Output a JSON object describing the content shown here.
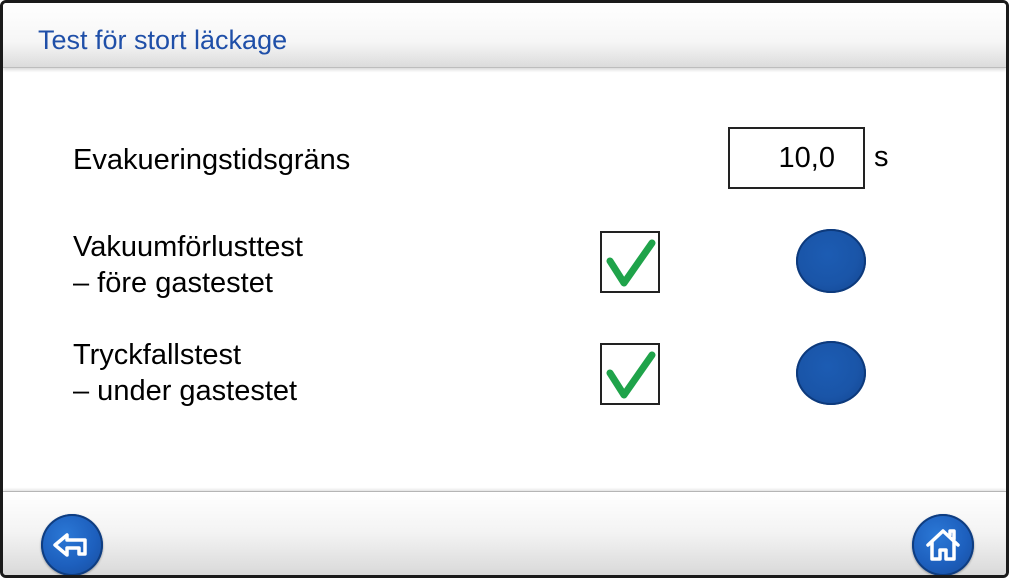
{
  "header": {
    "title": "Test för stort läckage"
  },
  "settings": {
    "evacuation_time": {
      "label": "Evakueringstidsgräns",
      "value": "10,0",
      "unit": "s"
    },
    "vacuum_loss_test": {
      "label_line1": "Vakuumförlusttest",
      "label_line2": "– före gastestet",
      "checked": true,
      "indicator_color": "#1a55a8"
    },
    "pressure_drop_test": {
      "label_line1": "Tryckfallstest",
      "label_line2": "– under gastestet",
      "checked": true,
      "indicator_color": "#1a55a8"
    }
  },
  "footer": {
    "back_icon": "back-arrow-icon",
    "home_icon": "home-icon"
  },
  "colors": {
    "title": "#1f4fa8",
    "button": "#1d5fbd",
    "check": "#1fa34a"
  }
}
